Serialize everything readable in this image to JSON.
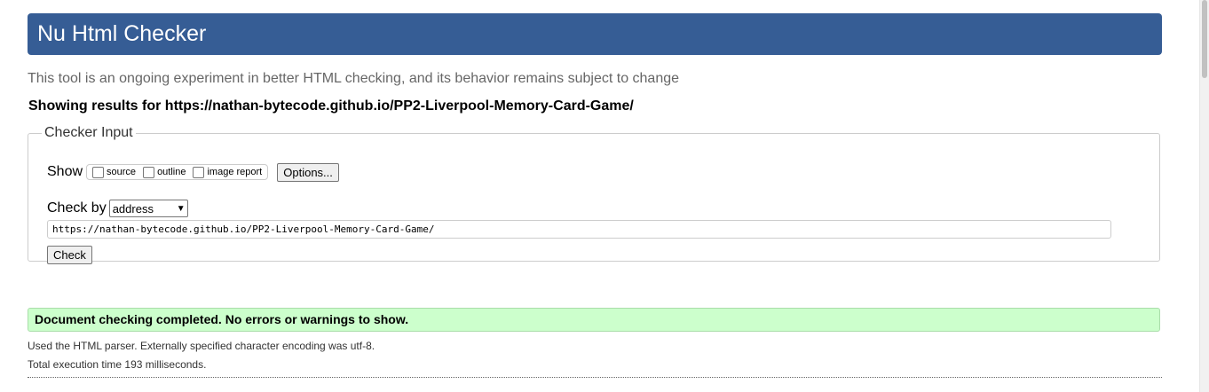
{
  "header": {
    "title": "Nu Html Checker",
    "color": "#365d95"
  },
  "intro": "This tool is an ongoing experiment in better HTML checking, and its behavior remains subject to change",
  "showing_results": "Showing results for https://nathan-bytecode.github.io/PP2-Liverpool-Memory-Card-Game/",
  "checker_input": {
    "legend": "Checker Input",
    "show_label": "Show",
    "show_options": [
      {
        "label": "source",
        "checked": false
      },
      {
        "label": "outline",
        "checked": false
      },
      {
        "label": "image report",
        "checked": false
      }
    ],
    "options_button": "Options...",
    "check_by_label": "Check by",
    "check_by_value": "address",
    "url_value": "https://nathan-bytecode.github.io/PP2-Liverpool-Memory-Card-Game/",
    "check_button": "Check"
  },
  "result": {
    "message": "Document checking completed. No errors or warnings to show.",
    "color": "#ccffcc"
  },
  "details": {
    "parser": "Used the HTML parser. Externally specified character encoding was utf-8.",
    "execution_time": "Total execution time 193 milliseconds."
  }
}
